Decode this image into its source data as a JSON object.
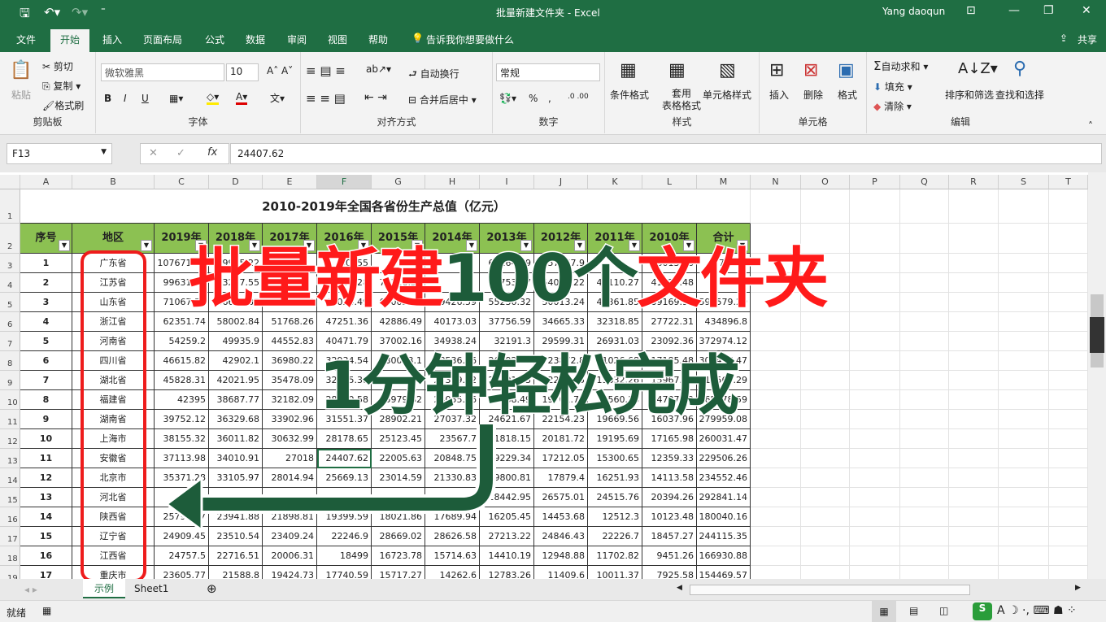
{
  "window": {
    "title": "批量新建文件夹 - Excel",
    "user": "Yang daoqun",
    "share": "共享"
  },
  "menu_tabs": [
    "文件",
    "开始",
    "插入",
    "页面布局",
    "公式",
    "数据",
    "审阅",
    "视图",
    "帮助"
  ],
  "tell_me": "告诉我你想要做什么",
  "ribbon": {
    "clipboard": {
      "paste": "粘贴",
      "cut": "剪切",
      "copy": "复制",
      "format_painter": "格式刷",
      "label": "剪贴板"
    },
    "font": {
      "name": "微软雅黑",
      "size": "10",
      "bold": "B",
      "italic": "I",
      "underline": "U",
      "label": "字体"
    },
    "alignment": {
      "wrap": "自动换行",
      "merge": "合并后居中",
      "label": "对齐方式"
    },
    "number": {
      "format": "常规",
      "percent": "%",
      "comma": ",",
      "label": "数字"
    },
    "styles": {
      "conditional": "条件格式",
      "table": "套用\n表格格式",
      "cell_styles": "单元格样式",
      "label": "样式"
    },
    "cells": {
      "insert": "插入",
      "delete": "删除",
      "format": "格式",
      "label": "单元格"
    },
    "editing": {
      "autosum": "自动求和",
      "fill": "填充",
      "clear": "清除",
      "sort": "排序和筛选",
      "find": "查找和选择",
      "label": "编辑"
    }
  },
  "formula_bar": {
    "name_box": "F13",
    "value": "24407.62"
  },
  "columns": [
    "A",
    "B",
    "C",
    "D",
    "E",
    "F",
    "G",
    "H",
    "I",
    "J",
    "K",
    "L",
    "M",
    "N",
    "O",
    "P",
    "Q",
    "R",
    "S",
    "T"
  ],
  "sheet": {
    "title": "2010-2019年全国各省份生产总值（亿元）",
    "headers": [
      "序号",
      "地区",
      "2019年",
      "2018年",
      "2017年",
      "2016年",
      "2015年",
      "2014年",
      "2013年",
      "2012年",
      "2011年",
      "2010年",
      "合计"
    ],
    "rows": [
      [
        "1",
        "广东省",
        "107671.07",
        "99945.22",
        "",
        "80855",
        "",
        "",
        "62164.79",
        "57067.9",
        "",
        "46013.06",
        "775664"
      ],
      [
        "2",
        "江苏省",
        "99631.52",
        "93207.55",
        "",
        "77388.28",
        "70116.38",
        "",
        "59753.37",
        "54058.22",
        "49110.27",
        "41425.48",
        ""
      ],
      [
        "3",
        "山东省",
        "71067.53",
        "66648.87",
        "72634.15",
        "68024.49",
        "63002.33",
        "59426.59",
        "55230.32",
        "50013.24",
        "45361.85",
        "39169.92",
        "590579.29"
      ],
      [
        "4",
        "浙江省",
        "62351.74",
        "58002.84",
        "51768.26",
        "47251.36",
        "42886.49",
        "40173.03",
        "37756.59",
        "34665.33",
        "32318.85",
        "27722.31",
        "434896.8"
      ],
      [
        "5",
        "河南省",
        "54259.2",
        "49935.9",
        "44552.83",
        "40471.79",
        "37002.16",
        "34938.24",
        "32191.3",
        "29599.31",
        "26931.03",
        "23092.36",
        "372974.12"
      ],
      [
        "6",
        "四川省",
        "46615.82",
        "42902.1",
        "36980.22",
        "32934.54",
        "30053.1",
        "28536.66",
        "26392.07",
        "23872.8",
        "21026.68",
        "17185.48",
        "306497.47"
      ],
      [
        "7",
        "湖北省",
        "45828.31",
        "42021.95",
        "35478.09",
        "32665.38",
        "29550.19",
        "27379.22",
        "24791.83",
        "22250.45",
        "19632.26",
        "15967.61",
        "315564.29"
      ],
      [
        "8",
        "福建省",
        "42395",
        "38687.77",
        "32182.09",
        "28810.58",
        "25979.82",
        "24055.76",
        "21868.49",
        "19701.78",
        "17560.18",
        "14737.12",
        "265978.59"
      ],
      [
        "9",
        "湖南省",
        "39752.12",
        "36329.68",
        "33902.96",
        "31551.37",
        "28902.21",
        "27037.32",
        "24621.67",
        "22154.23",
        "19669.56",
        "16037.96",
        "279959.08"
      ],
      [
        "10",
        "上海市",
        "38155.32",
        "36011.82",
        "30632.99",
        "28178.65",
        "25123.45",
        "23567.7",
        "21818.15",
        "20181.72",
        "19195.69",
        "17165.98",
        "260031.47"
      ],
      [
        "11",
        "安徽省",
        "37113.98",
        "34010.91",
        "27018",
        "24407.62",
        "22005.63",
        "20848.75",
        "19229.34",
        "17212.05",
        "15300.65",
        "12359.33",
        "229506.26"
      ],
      [
        "12",
        "北京市",
        "35371.28",
        "33105.97",
        "28014.94",
        "25669.13",
        "23014.59",
        "21330.83",
        "19800.81",
        "17879.4",
        "16251.93",
        "14113.58",
        "234552.46"
      ],
      [
        "13",
        "河北省",
        "",
        "",
        "",
        "",
        "",
        "",
        "28442.95",
        "26575.01",
        "24515.76",
        "20394.26",
        "292841.14"
      ],
      [
        "14",
        "陕西省",
        "25793.17",
        "23941.88",
        "21898.81",
        "19399.59",
        "18021.86",
        "17689.94",
        "16205.45",
        "14453.68",
        "12512.3",
        "10123.48",
        "180040.16"
      ],
      [
        "15",
        "辽宁省",
        "24909.45",
        "23510.54",
        "23409.24",
        "22246.9",
        "28669.02",
        "28626.58",
        "27213.22",
        "24846.43",
        "22226.7",
        "18457.27",
        "244115.35"
      ],
      [
        "16",
        "江西省",
        "24757.5",
        "22716.51",
        "20006.31",
        "18499",
        "16723.78",
        "15714.63",
        "14410.19",
        "12948.88",
        "11702.82",
        "9451.26",
        "166930.88"
      ],
      [
        "17",
        "重庆市",
        "23605.77",
        "21588.8",
        "19424.73",
        "17740.59",
        "15717.27",
        "14262.6",
        "12783.26",
        "11409.6",
        "10011.37",
        "7925.58",
        "154469.57"
      ]
    ]
  },
  "overlay": {
    "line1_a": "批量新建",
    "line1_b": "100个",
    "line1_c": "文件夹",
    "line2": "1分钟轻松完成",
    "red": "#ff1a1a",
    "green": "#1d5c3a"
  },
  "sheet_tabs": [
    "示例",
    "Sheet1"
  ],
  "status": {
    "ready": "就绪"
  }
}
